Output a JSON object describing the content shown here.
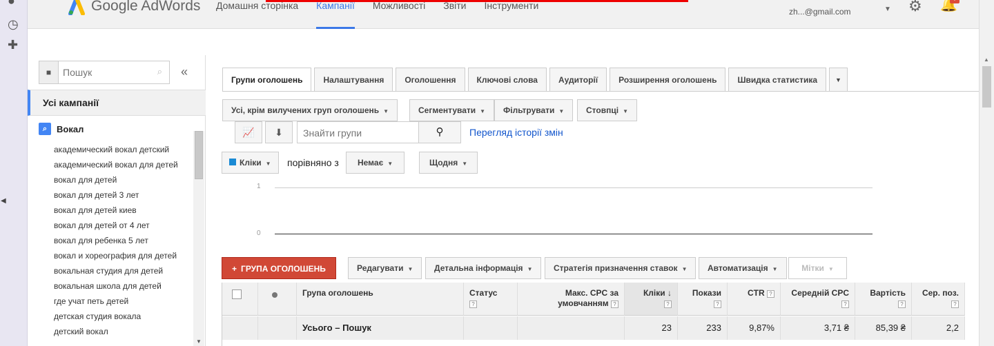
{
  "app": {
    "logo_text": "Google AdWords"
  },
  "nav": {
    "items": [
      "Домашня сторінка",
      "Кампанії",
      "Можливості",
      "Звіти",
      "Інструменти"
    ],
    "active_index": 1
  },
  "account": {
    "email": "zh...@gmail.com",
    "notification_count": "!"
  },
  "sidebar": {
    "search_placeholder": "Пошук",
    "collapse_label": "«",
    "all_campaigns": "Усі кампанії",
    "campaign_name": "Вокал",
    "ad_groups": [
      "академический вокал детский",
      "академический вокал для детей",
      "вокал для детей",
      "вокал для детей 3 лет",
      "вокал для детей киев",
      "вокал для детей от 4 лет",
      "вокал для ребенка 5 лет",
      "вокал и хореография для детей",
      "вокальная студия для детей",
      "вокальная школа для детей",
      "где учат петь детей",
      "детская студия вокала",
      "детский вокал"
    ]
  },
  "tabs": [
    "Групи оголошень",
    "Налаштування",
    "Оголошення",
    "Ключові слова",
    "Аудиторії",
    "Розширення оголошень",
    "Швидка статистика"
  ],
  "toolbar": {
    "filter_scope": "Усі, крім вилучених груп оголошень",
    "segment": "Сегментувати",
    "filter": "Фільтрувати",
    "columns": "Стовпці",
    "find_placeholder": "Знайти групи",
    "history_link": "Перегляд історії змін"
  },
  "chart_controls": {
    "metric": "Кліки",
    "compare_label": "порівняно з",
    "compare_value": "Немає",
    "period": "Щодня"
  },
  "chart_data": {
    "type": "line",
    "yticks": [
      "1",
      "0"
    ],
    "ylim": [
      0,
      1
    ],
    "series": [
      {
        "values": []
      }
    ]
  },
  "actions": {
    "add_group": "ГРУПА ОГОЛОШЕНЬ",
    "edit": "Редагувати",
    "details": "Детальна інформація",
    "bid_strategy": "Стратегія призначення ставок",
    "automation": "Автоматизація",
    "labels": "Мітки"
  },
  "table": {
    "headers": {
      "group": "Група оголошень",
      "status": "Статус",
      "max_cpc": "Макс. CPC за умовчанням",
      "clicks": "Кліки",
      "impr": "Покази",
      "ctr": "CTR",
      "avg_cpc": "Середній CPC",
      "cost": "Вартість",
      "avg_pos": "Сер. поз."
    },
    "total_row": {
      "label": "Усього – Пошук",
      "clicks": "23",
      "impr": "233",
      "ctr": "9,87%",
      "avg_cpc": "3,71 ₴",
      "cost": "85,39 ₴",
      "avg_pos": "2,2"
    }
  }
}
